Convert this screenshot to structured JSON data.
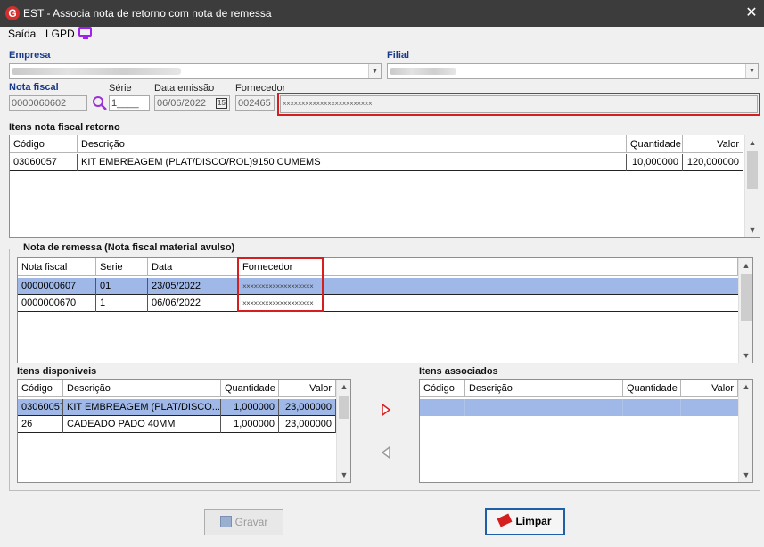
{
  "window": {
    "title": "EST - Associa nota de retorno com nota de remessa",
    "close": "✕",
    "app_icon": "G"
  },
  "menu": {
    "items": [
      "Saída",
      "LGPD"
    ],
    "monitor_icon": "monitor-icon"
  },
  "header": {
    "empresa_label": "Empresa",
    "filial_label": "Filial",
    "nota_fiscal_label": "Nota fiscal",
    "nota_fiscal_value": "0000060602",
    "serie_label": "Série",
    "serie_value": "1____",
    "data_emissao_label": "Data emissão",
    "data_emissao_value": "06/06/2022",
    "calendar_label": "15",
    "fornecedor_label": "Fornecedor",
    "fornecedor_code": "002465",
    "fornecedor_name": "××××××××××××××××××××××××"
  },
  "itens_retorno": {
    "title": "Itens nota fiscal retorno",
    "columns": [
      "Código",
      "Descrição",
      "Quantidade",
      "Valor"
    ],
    "rows": [
      [
        "03060057",
        "KIT EMBREAGEM (PLAT/DISCO/ROL)9150 CUMEMS",
        "10,000000",
        "120,000000"
      ]
    ]
  },
  "remessa": {
    "title": "Nota de remessa (Nota fiscal material avulso)",
    "columns": [
      "Nota fiscal",
      "Serie",
      "Data",
      "Fornecedor"
    ],
    "rows": [
      [
        "0000000607",
        "01",
        "23/05/2022",
        "×××××××××××××××××××"
      ],
      [
        "0000000670",
        "1",
        "06/06/2022",
        "×××××××××××××××××××"
      ]
    ]
  },
  "disponiveis": {
    "title": "Itens disponiveis",
    "columns": [
      "Código",
      "Descrição",
      "Quantidade",
      "Valor"
    ],
    "rows": [
      [
        "03060057",
        "KIT EMBREAGEM (PLAT/DISCO...",
        "1,000000",
        "23,000000"
      ],
      [
        "26",
        "CADEADO PADO 40MM",
        "1,000000",
        "23,000000"
      ]
    ]
  },
  "associados": {
    "title": "Itens associados",
    "columns": [
      "Código",
      "Descrição",
      "Quantidade",
      "Valor"
    ]
  },
  "buttons": {
    "gravar": "Gravar",
    "limpar": "Limpar"
  },
  "colors": {
    "accent_red": "#d71e1e",
    "selection": "#9fb8e7",
    "titlebar": "#3c3c3c"
  }
}
